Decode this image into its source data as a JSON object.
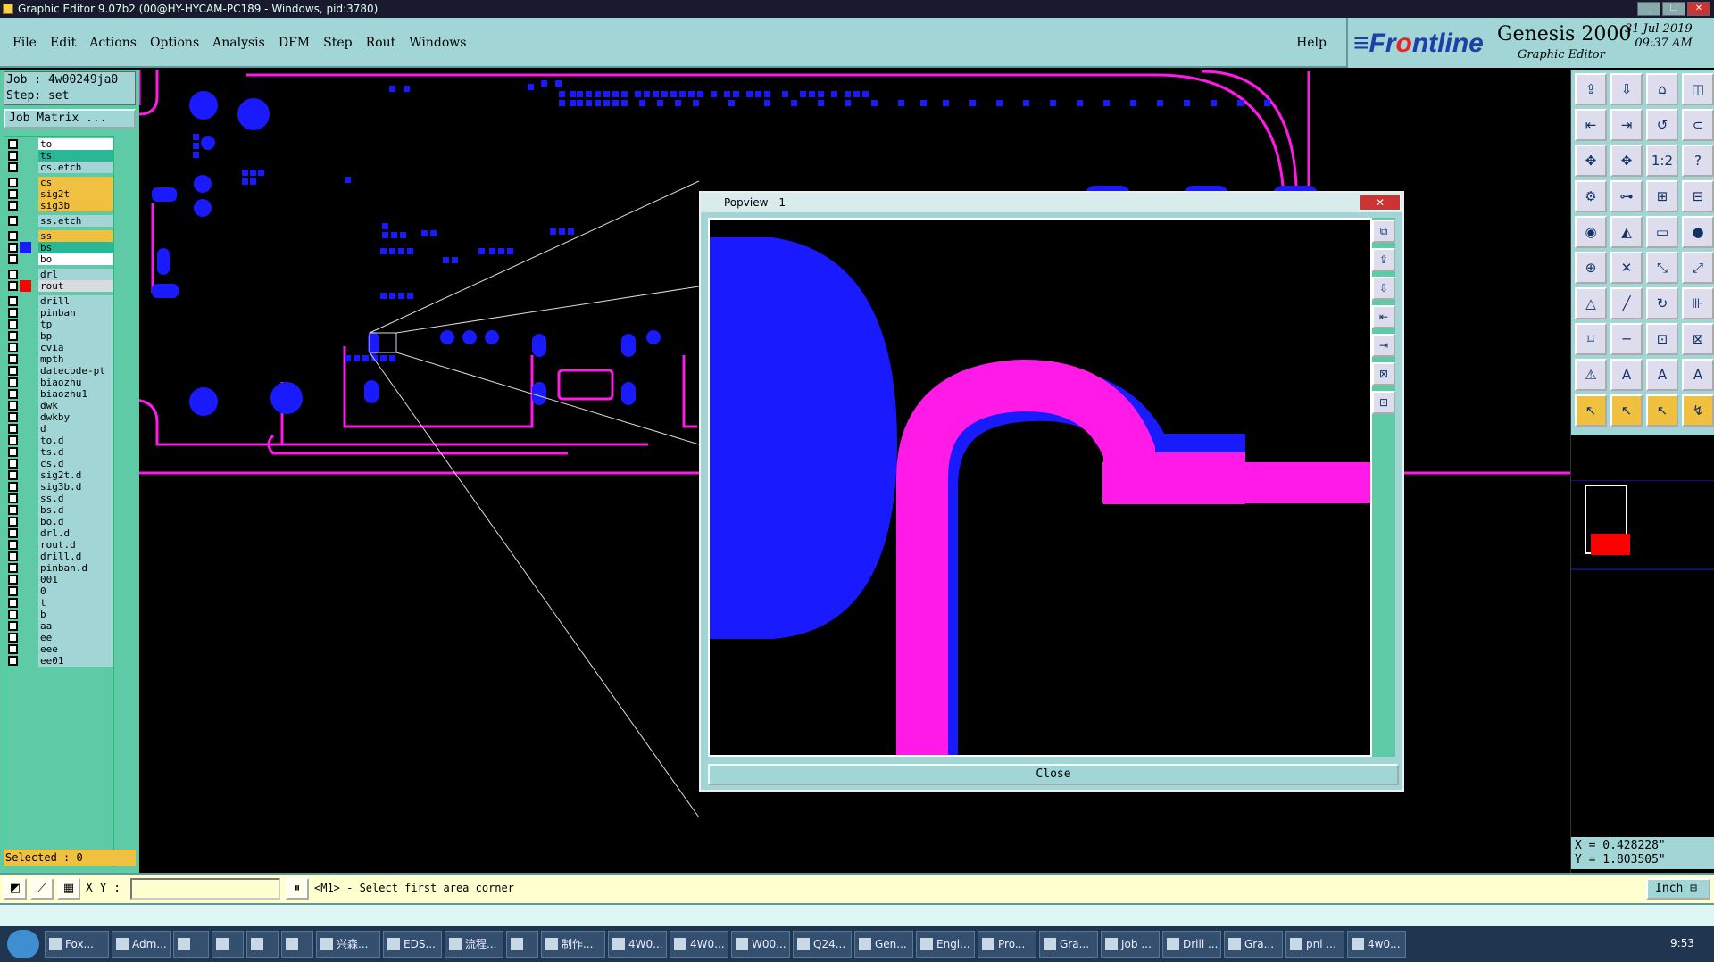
{
  "window": {
    "title": "Graphic Editor 9.07b2 (00@HY-HYCAM-PC189 - Windows, pid:3780)"
  },
  "menu": {
    "items": [
      "File",
      "Edit",
      "Actions",
      "Options",
      "Analysis",
      "DFM",
      "Step",
      "Rout",
      "Windows"
    ],
    "help": "Help"
  },
  "brand": {
    "logo_prefix": "≡Fr",
    "logo_o": "o",
    "logo_suffix": "ntline",
    "product": "Genesis 2000",
    "subtitle": "Graphic Editor",
    "date": "31 Jul 2019",
    "time": "09:37 AM"
  },
  "job": {
    "job_line": "Job : 4w00249ja0",
    "step_line": "Step: set",
    "matrix_button": "Job Matrix ..."
  },
  "layers": [
    {
      "name": "to",
      "bg": "#ffffff",
      "swatch": ""
    },
    {
      "name": "ts",
      "bg": "#28b898",
      "swatch": ""
    },
    {
      "name": "cs.etch",
      "bg": "#a2d6d6",
      "swatch": ""
    },
    {
      "name": "cs",
      "bg": "#f0c040",
      "swatch": ""
    },
    {
      "name": "sig2t",
      "bg": "#f0c040",
      "swatch": ""
    },
    {
      "name": "sig3b",
      "bg": "#f0c040",
      "swatch": ""
    },
    {
      "name": "ss.etch",
      "bg": "#a2d6d6",
      "swatch": ""
    },
    {
      "name": "ss",
      "bg": "#f0c040",
      "swatch": ""
    },
    {
      "name": "bs",
      "bg": "#28b898",
      "swatch": "#1a1aff"
    },
    {
      "name": "bo",
      "bg": "#ffffff",
      "swatch": ""
    },
    {
      "name": "drl",
      "bg": "#a2d6d6",
      "swatch": ""
    },
    {
      "name": "rout",
      "bg": "#d8dcdc",
      "swatch": "#ff0000"
    },
    {
      "name": "drill",
      "bg": "#a2d6d6",
      "swatch": ""
    },
    {
      "name": "pinban",
      "bg": "#a2d6d6",
      "swatch": ""
    },
    {
      "name": "tp",
      "bg": "#a2d6d6",
      "swatch": ""
    },
    {
      "name": "bp",
      "bg": "#a2d6d6",
      "swatch": ""
    },
    {
      "name": "cvia",
      "bg": "#a2d6d6",
      "swatch": ""
    },
    {
      "name": "mpth",
      "bg": "#a2d6d6",
      "swatch": ""
    },
    {
      "name": "datecode-pt",
      "bg": "#a2d6d6",
      "swatch": ""
    },
    {
      "name": "biaozhu",
      "bg": "#a2d6d6",
      "swatch": ""
    },
    {
      "name": "biaozhu1",
      "bg": "#a2d6d6",
      "swatch": ""
    },
    {
      "name": "dwk",
      "bg": "#a2d6d6",
      "swatch": ""
    },
    {
      "name": "dwkby",
      "bg": "#a2d6d6",
      "swatch": ""
    },
    {
      "name": "d",
      "bg": "#a2d6d6",
      "swatch": ""
    },
    {
      "name": "to.d",
      "bg": "#a2d6d6",
      "swatch": ""
    },
    {
      "name": "ts.d",
      "bg": "#a2d6d6",
      "swatch": ""
    },
    {
      "name": "cs.d",
      "bg": "#a2d6d6",
      "swatch": ""
    },
    {
      "name": "sig2t.d",
      "bg": "#a2d6d6",
      "swatch": ""
    },
    {
      "name": "sig3b.d",
      "bg": "#a2d6d6",
      "swatch": ""
    },
    {
      "name": "ss.d",
      "bg": "#a2d6d6",
      "swatch": ""
    },
    {
      "name": "bs.d",
      "bg": "#a2d6d6",
      "swatch": ""
    },
    {
      "name": "bo.d",
      "bg": "#a2d6d6",
      "swatch": ""
    },
    {
      "name": "drl.d",
      "bg": "#a2d6d6",
      "swatch": ""
    },
    {
      "name": "rout.d",
      "bg": "#a2d6d6",
      "swatch": ""
    },
    {
      "name": "drill.d",
      "bg": "#a2d6d6",
      "swatch": ""
    },
    {
      "name": "pinban.d",
      "bg": "#a2d6d6",
      "swatch": ""
    },
    {
      "name": "001",
      "bg": "#a2d6d6",
      "swatch": ""
    },
    {
      "name": "0",
      "bg": "#a2d6d6",
      "swatch": ""
    },
    {
      "name": "t",
      "bg": "#a2d6d6",
      "swatch": ""
    },
    {
      "name": "b",
      "bg": "#a2d6d6",
      "swatch": ""
    },
    {
      "name": "aa",
      "bg": "#a2d6d6",
      "swatch": ""
    },
    {
      "name": "ee",
      "bg": "#a2d6d6",
      "swatch": ""
    },
    {
      "name": "eee",
      "bg": "#a2d6d6",
      "swatch": ""
    },
    {
      "name": "ee01",
      "bg": "#a2d6d6",
      "swatch": ""
    }
  ],
  "selected": "Selected : 0",
  "popview": {
    "title": "Popview - 1",
    "close_label": "Close",
    "close_x": "✕"
  },
  "coords": {
    "x": "X = 0.428228\"",
    "y": "Y = 1.803505\""
  },
  "status": {
    "xy_label": "X Y :",
    "xy_value": "",
    "prompt": "<M1> - Select first area corner",
    "units": "Inch"
  },
  "colors": {
    "pad": "#1a1aff",
    "trace": "#ff1ae8",
    "panel": "#a2d6d6",
    "layer_panel": "#5fcaa6"
  },
  "taskbar": {
    "items": [
      "Fox...",
      "Adm...",
      "",
      "",
      "",
      "",
      "兴森...",
      "EDS...",
      "流程...",
      "",
      "制作...",
      "4W0...",
      "4W0...",
      "W00...",
      "Q24...",
      "Gen...",
      "Engi...",
      "Pro...",
      "Gra...",
      "Job ...",
      "Drill ...",
      "Gra...",
      "pnl ...",
      "4w0..."
    ],
    "clock": "9:53"
  }
}
